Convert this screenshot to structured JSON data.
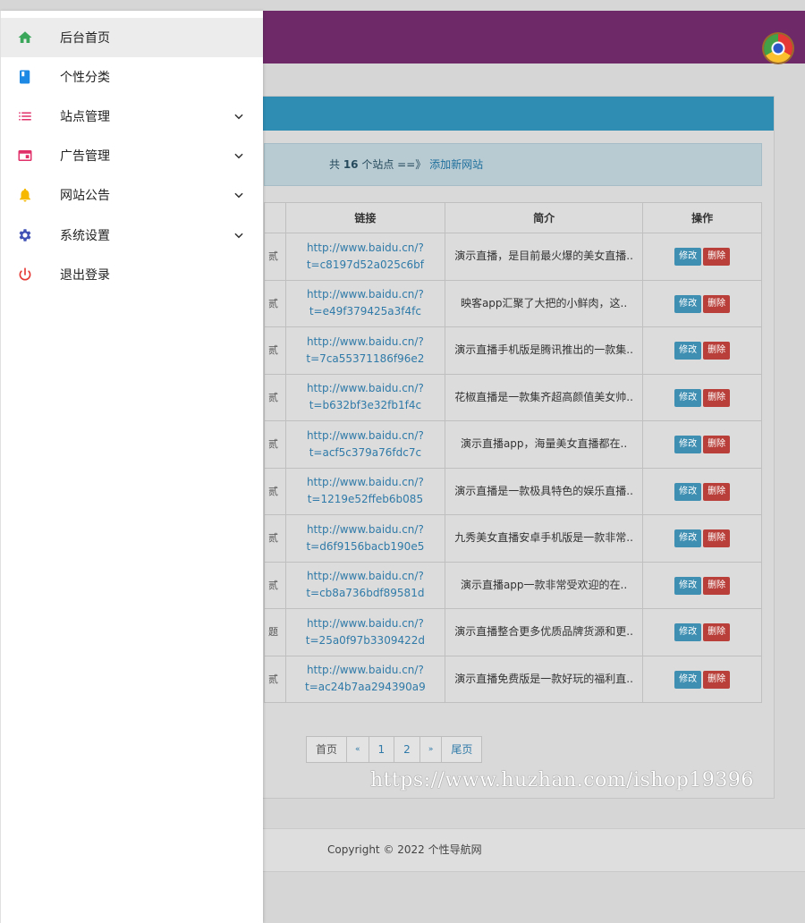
{
  "sidebar": {
    "items": [
      {
        "label": "后台首页",
        "icon": "home-icon",
        "color": "#3aa65a",
        "expandable": false,
        "active": true
      },
      {
        "label": "个性分类",
        "icon": "book-icon",
        "color": "#1e88e5",
        "expandable": false
      },
      {
        "label": "站点管理",
        "icon": "list-icon",
        "color": "#e0316a",
        "expandable": true
      },
      {
        "label": "广告管理",
        "icon": "ad-card-icon",
        "color": "#e0316a",
        "expandable": true
      },
      {
        "label": "网站公告",
        "icon": "bell-icon",
        "color": "#f6b800",
        "expandable": true
      },
      {
        "label": "系统设置",
        "icon": "gear-icon",
        "color": "#3f51b5",
        "expandable": true
      },
      {
        "label": "退出登录",
        "icon": "power-icon",
        "color": "#e53935",
        "expandable": false
      }
    ]
  },
  "summary": {
    "prefix": "共 ",
    "count": "16",
    "suffix": " 个站点 ==》",
    "add_link": "添加新网站"
  },
  "table": {
    "headers": {
      "link": "链接",
      "desc": "简介",
      "actions": "操作"
    },
    "edit_label": "修改",
    "delete_label": "删除",
    "rows": [
      {
        "cut": "贰",
        "link1": "http://www.baidu.cn/?",
        "link2": "t=c8197d52a025c6bf",
        "desc": "演示直播，是目前最火爆的美女直播.."
      },
      {
        "cut": "贰",
        "link1": "http://www.baidu.cn/?",
        "link2": "t=e49f379425a3f4fc",
        "desc": "映客app汇聚了大把的小鲜肉，这.."
      },
      {
        "cut": "贰",
        "link1": "http://www.baidu.cn/?",
        "link2": "t=7ca55371186f96e2",
        "desc": "演示直播手机版是腾讯推出的一款集.."
      },
      {
        "cut": "贰",
        "link1": "http://www.baidu.cn/?",
        "link2": "t=b632bf3e32fb1f4c",
        "desc": "花椒直播是一款集齐超高颜值美女帅.."
      },
      {
        "cut": "贰",
        "link1": "http://www.baidu.cn/?",
        "link2": "t=acf5c379a76fdc7c",
        "desc": "演示直播app，海量美女直播都在.."
      },
      {
        "cut": "贰",
        "link1": "http://www.baidu.cn/?",
        "link2": "t=1219e52ffeb6b085",
        "desc": "演示直播是一款极具特色的娱乐直播.."
      },
      {
        "cut": "贰",
        "link1": "http://www.baidu.cn/?",
        "link2": "t=d6f9156bacb190e5",
        "desc": "九秀美女直播安卓手机版是一款非常.."
      },
      {
        "cut": "贰",
        "link1": "http://www.baidu.cn/?",
        "link2": "t=cb8a736bdf89581d",
        "desc": "演示直播app一款非常受欢迎的在.."
      },
      {
        "cut": "题",
        "link1": "http://www.baidu.cn/?",
        "link2": "t=25a0f97b3309422d",
        "desc": "演示直播整合更多优质品牌货源和更.."
      },
      {
        "cut": "贰",
        "link1": "http://www.baidu.cn/?",
        "link2": "t=ac24b7aa294390a9",
        "desc": "演示直播免费版是一款好玩的福利直.."
      }
    ]
  },
  "pagination": {
    "first": "首页",
    "prev": "«",
    "pages": [
      "1",
      "2"
    ],
    "next": "»",
    "last": "尾页"
  },
  "footer": {
    "copyright": "Copyright © 2022 个性导航网"
  },
  "watermark": "https://www.huzhan.com/ishop19396",
  "colors": {
    "topbar": "#6e2a68",
    "panel_header": "#2f8db4",
    "link": "#2f7aa8",
    "edit": "#3f8fb2",
    "delete": "#b9403a"
  }
}
